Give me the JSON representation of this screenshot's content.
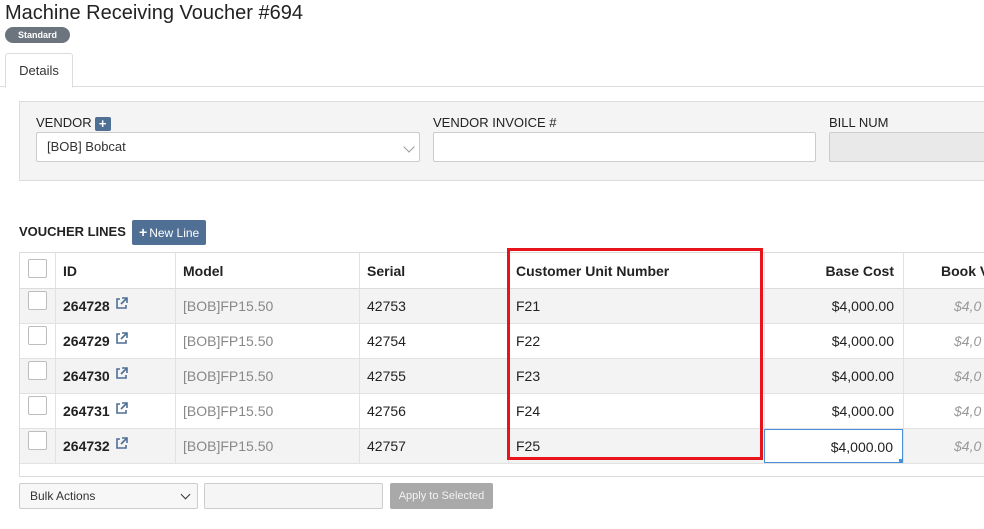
{
  "header": {
    "title": "Machine Receiving Voucher #694",
    "badge": "Standard"
  },
  "tabs": [
    {
      "label": "Details",
      "active": true
    }
  ],
  "form": {
    "vendor_label": "VENDOR",
    "vendor_add_icon": "+",
    "vendor_value": "[BOB] Bobcat",
    "vendor_invoice_label": "VENDOR INVOICE #",
    "vendor_invoice_value": "",
    "bill_num_label": "BILL NUM",
    "bill_num_value": ""
  },
  "voucher_lines": {
    "title": "VOUCHER LINES",
    "new_line_label": "New Line",
    "new_line_icon": "+",
    "columns": [
      "ID",
      "Model",
      "Serial",
      "Customer Unit Number",
      "Base Cost",
      "Book V"
    ],
    "rows": [
      {
        "id": "264728",
        "model": "[BOB]FP15.50",
        "serial": "42753",
        "customer_unit": "F21",
        "base_cost": "$4,000.00",
        "book_value": "$4,0"
      },
      {
        "id": "264729",
        "model": "[BOB]FP15.50",
        "serial": "42754",
        "customer_unit": "F22",
        "base_cost": "$4,000.00",
        "book_value": "$4,0"
      },
      {
        "id": "264730",
        "model": "[BOB]FP15.50",
        "serial": "42755",
        "customer_unit": "F23",
        "base_cost": "$4,000.00",
        "book_value": "$4,0"
      },
      {
        "id": "264731",
        "model": "[BOB]FP15.50",
        "serial": "42756",
        "customer_unit": "F24",
        "base_cost": "$4,000.00",
        "book_value": "$4,0"
      },
      {
        "id": "264732",
        "model": "[BOB]FP15.50",
        "serial": "42757",
        "customer_unit": "F25",
        "base_cost": "$4,000.00",
        "book_value": "$4,0"
      }
    ]
  },
  "footer": {
    "bulk_actions_label": "Bulk Actions",
    "bulk_input_value": "",
    "apply_label": "Apply to Selected"
  },
  "colors": {
    "accent": "#4f6f95",
    "highlight": "#e8141c",
    "badge": "#6c757d"
  },
  "icons": {
    "external_link": "external-link-icon",
    "dropdown": "chevron-down-icon",
    "add": "plus-icon"
  }
}
